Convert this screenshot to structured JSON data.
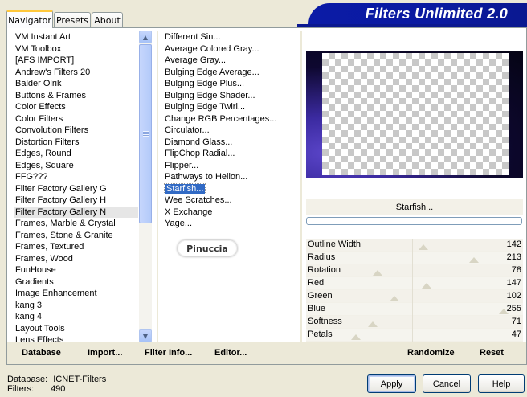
{
  "header": {
    "title": "Filters Unlimited 2.0"
  },
  "tabs": [
    {
      "label": "Navigator",
      "active": true
    },
    {
      "label": "Presets",
      "active": false
    },
    {
      "label": "About",
      "active": false
    }
  ],
  "categories": {
    "items": [
      "VM Instant Art",
      "VM Toolbox",
      "[AFS IMPORT]",
      "Andrew's Filters 20",
      "Balder Olrik",
      "Buttons & Frames",
      "Color Effects",
      "Color Filters",
      "Convolution Filters",
      "Distortion Filters",
      "Edges, Round",
      "Edges, Square",
      "FFG???",
      "Filter Factory Gallery G",
      "Filter Factory Gallery H",
      "Filter Factory Gallery N",
      "Frames, Marble & Crystal",
      "Frames, Stone & Granite",
      "Frames, Textured",
      "Frames, Wood",
      "FunHouse",
      "Gradients",
      "Image Enhancement",
      "kang 3",
      "kang 4",
      "Layout Tools",
      "Lens Effects"
    ],
    "selected": "Filter Factory Gallery N"
  },
  "filters": {
    "items": [
      "Different Sin...",
      "Average Colored Gray...",
      "Average Gray...",
      "Bulging Edge Average...",
      "Bulging Edge Plus...",
      "Bulging Edge Shader...",
      "Bulging Edge Twirl...",
      "Change RGB Percentages...",
      "Circulator...",
      "Diamond Glass...",
      "FlipChop Radial...",
      "Flipper...",
      "Pathways to Helion...",
      "Starfish...",
      "Wee Scratches...",
      "X Exchange",
      "Yage..."
    ],
    "selected": "Starfish..."
  },
  "logo": {
    "text": "Pinuccia"
  },
  "preview": {
    "filter_name": "Starfish..."
  },
  "sliders": [
    {
      "label": "Outline Width",
      "value": "142",
      "level": 0.557
    },
    {
      "label": "Radius",
      "value": "213",
      "level": 0.835
    },
    {
      "label": "Rotation",
      "value": "78",
      "level": 0.306
    },
    {
      "label": "Red",
      "value": "147",
      "level": 0.576
    },
    {
      "label": "Green",
      "value": "102",
      "level": 0.4
    },
    {
      "label": "Blue",
      "value": "255",
      "level": 1.0
    },
    {
      "label": "Softness",
      "value": "71",
      "level": 0.278
    },
    {
      "label": "Petals",
      "value": "47",
      "level": 0.184
    }
  ],
  "toolbar": {
    "database": "Database",
    "import": "Import...",
    "filter_info": "Filter Info...",
    "editor": "Editor...",
    "randomize": "Randomize",
    "reset": "Reset"
  },
  "status": {
    "database_label": "Database:",
    "database_value": "ICNET-Filters",
    "filters_label": "Filters:",
    "filters_value": "490"
  },
  "buttons": {
    "apply": "Apply",
    "cancel": "Cancel",
    "help": "Help"
  }
}
